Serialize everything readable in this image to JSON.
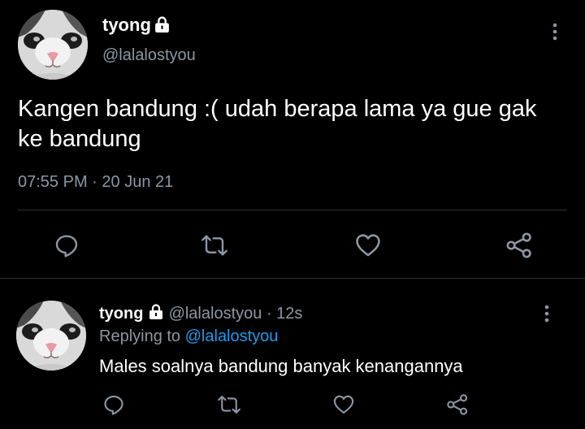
{
  "main_tweet": {
    "display_name": "tyong",
    "handle": "@lalalostyou",
    "text": "Kangen bandung :( udah berapa lama ya gue gak ke bandung",
    "time": "07:55 PM",
    "separator": "·",
    "date": "20 Jun 21",
    "avatar_icon": "cat-face-avatar",
    "protected_icon": "lock-icon"
  },
  "reply": {
    "display_name": "tyong",
    "handle": "@lalalostyou",
    "separator": "·",
    "age": "12s",
    "replying_label": "Replying to",
    "replying_handle": "@lalalostyou",
    "text": "Males soalnya bandung banyak kenangannya",
    "avatar_icon": "cat-face-avatar",
    "protected_icon": "lock-icon"
  },
  "actions": [
    "reply-icon",
    "retweet-icon",
    "like-icon",
    "share-icon"
  ],
  "colors": {
    "background": "#000000",
    "text": "#ffffff",
    "secondary": "#8b98a5",
    "link": "#1d9bf0",
    "divider": "#2f3336"
  }
}
